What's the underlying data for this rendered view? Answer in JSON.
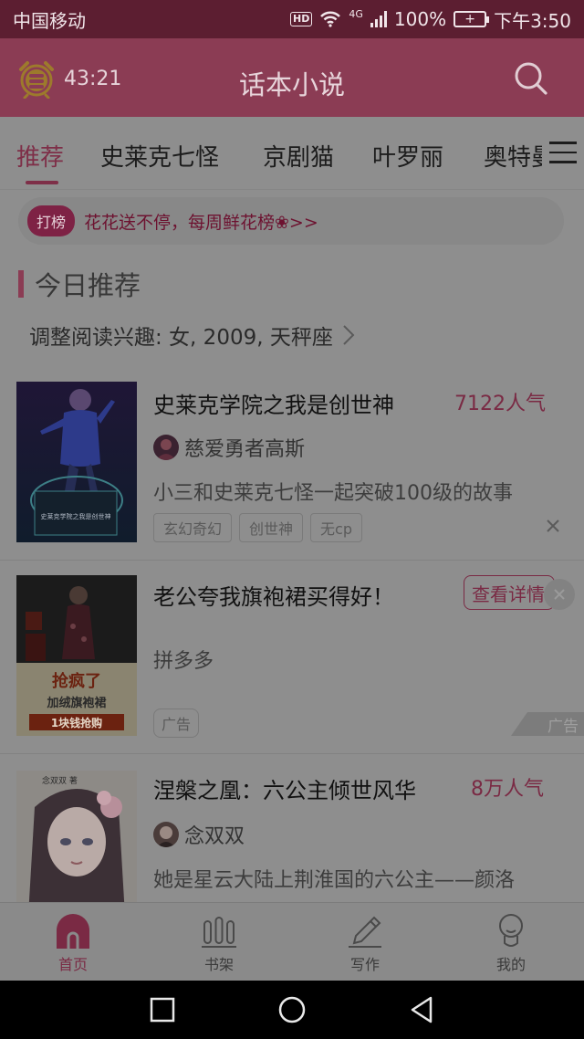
{
  "status_bar": {
    "carrier": "中国移动",
    "hd": "HD",
    "network": "4G",
    "battery": "100%",
    "time": "下午3:50"
  },
  "header": {
    "timer": "43:21",
    "title": "话本小说",
    "alarm_icon": "alarm-clock-icon",
    "search_icon": "search-icon"
  },
  "tabs": [
    {
      "label": "推荐",
      "active": true
    },
    {
      "label": "史莱克七怪"
    },
    {
      "label": "京剧猫"
    },
    {
      "label": "叶罗丽"
    },
    {
      "label": "奥特曼"
    }
  ],
  "banner": {
    "badge": "打榜",
    "text": "花花送不停，每周鲜花榜❀>>"
  },
  "section": {
    "title": "今日推荐",
    "interest": "调整阅读兴趣: 女, 2009, 天秤座"
  },
  "books": [
    {
      "title": "史莱克学院之我是创世神",
      "popularity": "7122人气",
      "author": "慈爱勇者高斯",
      "description": "小三和史莱克七怪一起突破100级的故事",
      "tags": [
        "玄幻奇幻",
        "创世神",
        "无cp"
      ],
      "cover_text": "史莱克学院之我是创世神"
    },
    {
      "title": "涅槃之凰：六公主倾世风华",
      "popularity": "8万人气",
      "author": "念双双",
      "description": "她是星云大陆上荆淮国的六公主——颜洛",
      "cover_text": "念双双 著"
    }
  ],
  "ad": {
    "title": "老公夸我旗袍裙买得好！",
    "button": "查看详情",
    "sponsor": "拼多多",
    "tag": "广告",
    "corner_label": "广告",
    "image_lines": [
      "抢疯了",
      "加绒旗袍裙",
      "1块钱抢购"
    ]
  },
  "bottom_nav": [
    {
      "label": "首页",
      "icon": "home-icon",
      "active": true
    },
    {
      "label": "书架",
      "icon": "bookshelf-icon"
    },
    {
      "label": "写作",
      "icon": "pen-icon"
    },
    {
      "label": "我的",
      "icon": "profile-icon"
    }
  ],
  "colors": {
    "header": "#8b3c54",
    "accent": "#7e2f48",
    "status_bar": "#5c1e31",
    "overlay_bg": "#8e8e8e"
  }
}
